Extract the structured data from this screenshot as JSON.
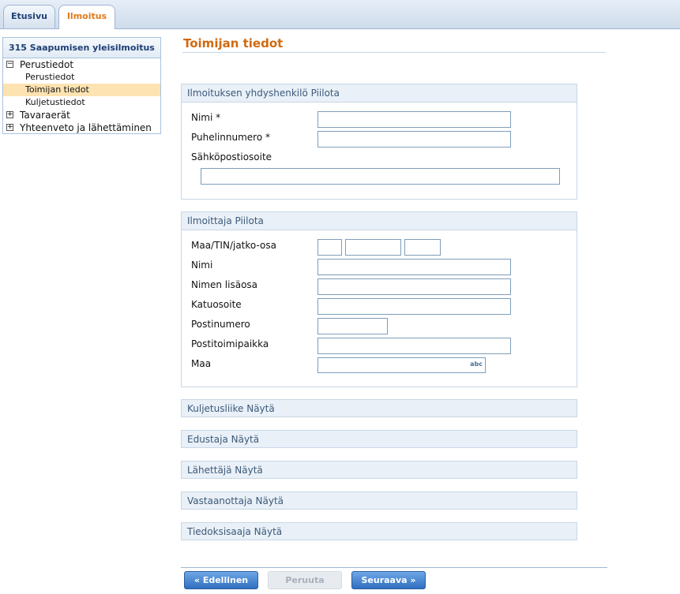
{
  "tabs": {
    "home": "Etusivu",
    "notice": "Ilmoitus"
  },
  "nav": {
    "title": "315 Saapumisen yleisilmoitus",
    "sections": [
      {
        "label": "Perustiedot",
        "toggle": "−"
      },
      {
        "label": "Tavaraerät",
        "toggle": "+"
      },
      {
        "label": "Yhteenveto ja lähettäminen",
        "toggle": "+"
      }
    ],
    "subitems": [
      "Perustiedot",
      "Toimijan tiedot",
      "Kuljetustiedot"
    ]
  },
  "page": {
    "title": "Toimijan tiedot"
  },
  "contact": {
    "header": "Ilmoituksen yhdyshenkilö Piilota",
    "name_label": "Nimi *",
    "phone_label": "Puhelinnumero *",
    "email_label": "Sähköpostiosoite",
    "name_value": "",
    "phone_value": "",
    "email_value": ""
  },
  "notifier": {
    "header": "Ilmoittaja Piilota",
    "tin_label": "Maa/TIN/jatko-osa",
    "name_label": "Nimi",
    "name_ext_label": "Nimen lisäosa",
    "street_label": "Katuosoite",
    "postal_label": "Postinumero",
    "city_label": "Postitoimipaikka",
    "country_label": "Maa",
    "country_badge": "abc"
  },
  "collapsed_sections": [
    "Kuljetusliike Näytä",
    "Edustaja Näytä",
    "Lähettäjä Näytä",
    "Vastaanottaja Näytä",
    "Tiedoksisaaja Näytä"
  ],
  "buttons": {
    "prev": "Edellinen",
    "cancel": "Peruuta",
    "next": "Seuraava",
    "prev_icon": "«",
    "next_icon": "»"
  },
  "colors": {
    "accent": "#d06a10",
    "brand": "#2f6fc0",
    "selected": "#fde3b1"
  }
}
